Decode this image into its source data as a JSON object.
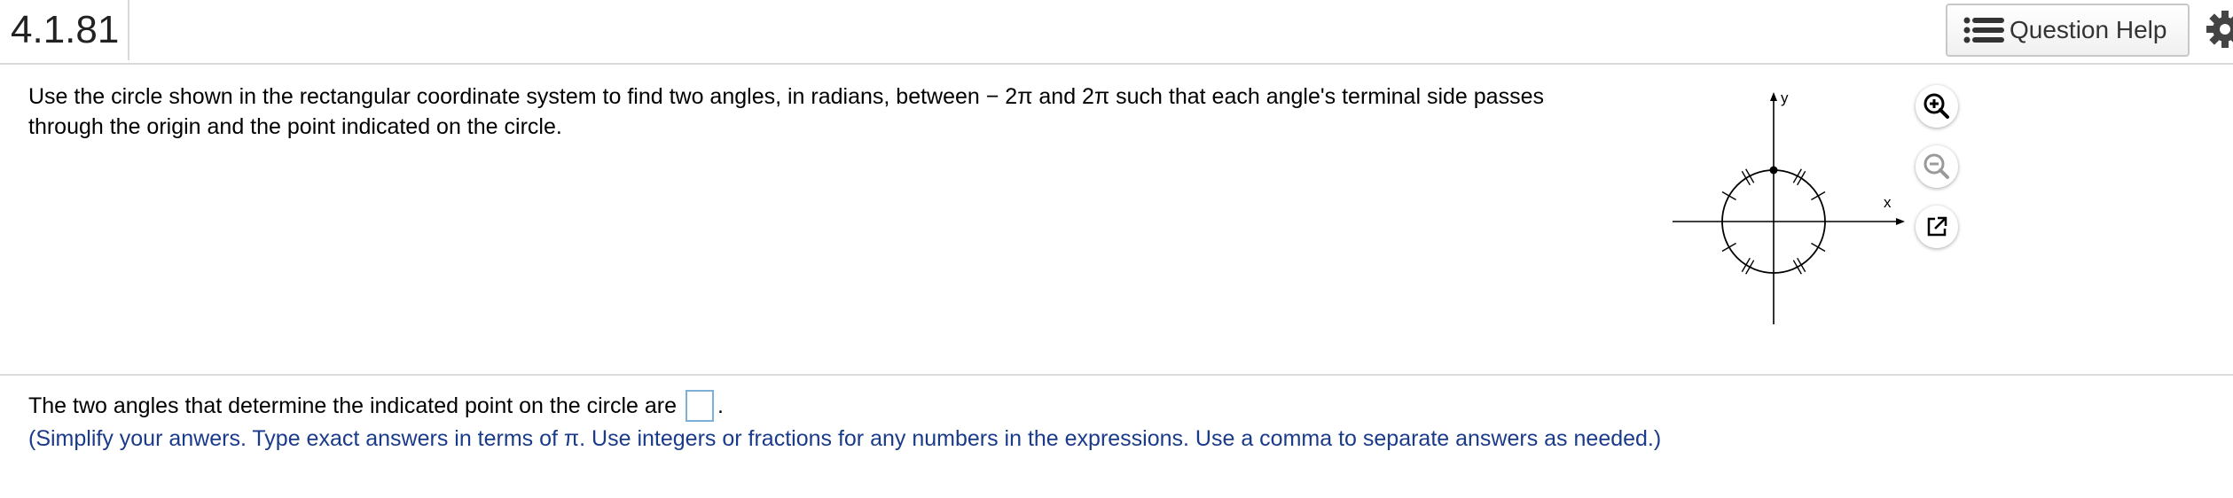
{
  "header": {
    "problem_id": "4.1.81",
    "help_label": "Question Help"
  },
  "question": {
    "text_line1": "Use the circle shown in the rectangular coordinate system to find two angles, in radians, between  − 2π and 2π such that each angle's terminal side passes",
    "text_line2": "through the origin and the point indicated on the circle."
  },
  "figure": {
    "x_label": "x",
    "y_label": "y",
    "tools": [
      "zoom-in-icon",
      "zoom-out-icon",
      "popout-icon"
    ]
  },
  "answer": {
    "prompt": "The two angles that determine the indicated point on the circle are",
    "value": "",
    "after": ".",
    "instructions": "(Simplify your anwers. Type exact answers in terms of π. Use integers or fractions for any numbers in the expressions. Use a comma to separate answers as needed.)"
  },
  "colors": {
    "instruction_text": "#1a3a8a",
    "answer_box_border": "#7db0d8",
    "divider": "#dcdcdc"
  }
}
